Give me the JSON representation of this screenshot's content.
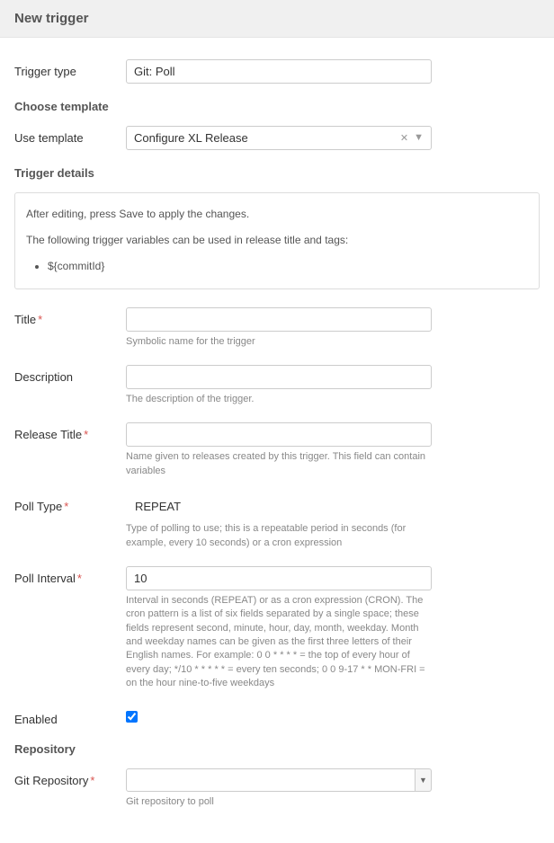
{
  "header": {
    "title": "New trigger"
  },
  "sections": {
    "trigger_type_label": "Trigger type",
    "choose_template": "Choose template",
    "use_template_label": "Use template",
    "trigger_details": "Trigger details",
    "repository": "Repository"
  },
  "trigger_type": {
    "value": "Git: Poll"
  },
  "use_template": {
    "value": "Configure XL Release"
  },
  "info": {
    "line1": "After editing, press Save to apply the changes.",
    "line2": "The following trigger variables can be used in release title and tags:",
    "var1": "${commitId}"
  },
  "fields": {
    "title": {
      "label": "Title",
      "help": "Symbolic name for the trigger",
      "value": ""
    },
    "description": {
      "label": "Description",
      "help": "The description of the trigger.",
      "value": ""
    },
    "release_title": {
      "label": "Release Title",
      "help": "Name given to releases created by this trigger. This field can contain variables",
      "value": ""
    },
    "poll_type": {
      "label": "Poll Type",
      "value": "REPEAT",
      "help": "Type of polling to use; this is a repeatable period in seconds (for example, every 10 seconds) or a cron expression"
    },
    "poll_interval": {
      "label": "Poll Interval",
      "value": "10",
      "help": "Interval in seconds (REPEAT) or as a cron expression (CRON). The cron pattern is a list of six fields separated by a single space; these fields represent second, minute, hour, day, month, weekday. Month and weekday names can be given as the first three letters of their English names. For example: 0 0 * * * * = the top of every hour of every day; */10 * * * * * = every ten seconds; 0 0 9-17 * * MON-FRI = on the hour nine-to-five weekdays"
    },
    "enabled": {
      "label": "Enabled",
      "checked": true
    },
    "git_repository": {
      "label": "Git Repository",
      "help": "Git repository to poll",
      "value": ""
    }
  }
}
